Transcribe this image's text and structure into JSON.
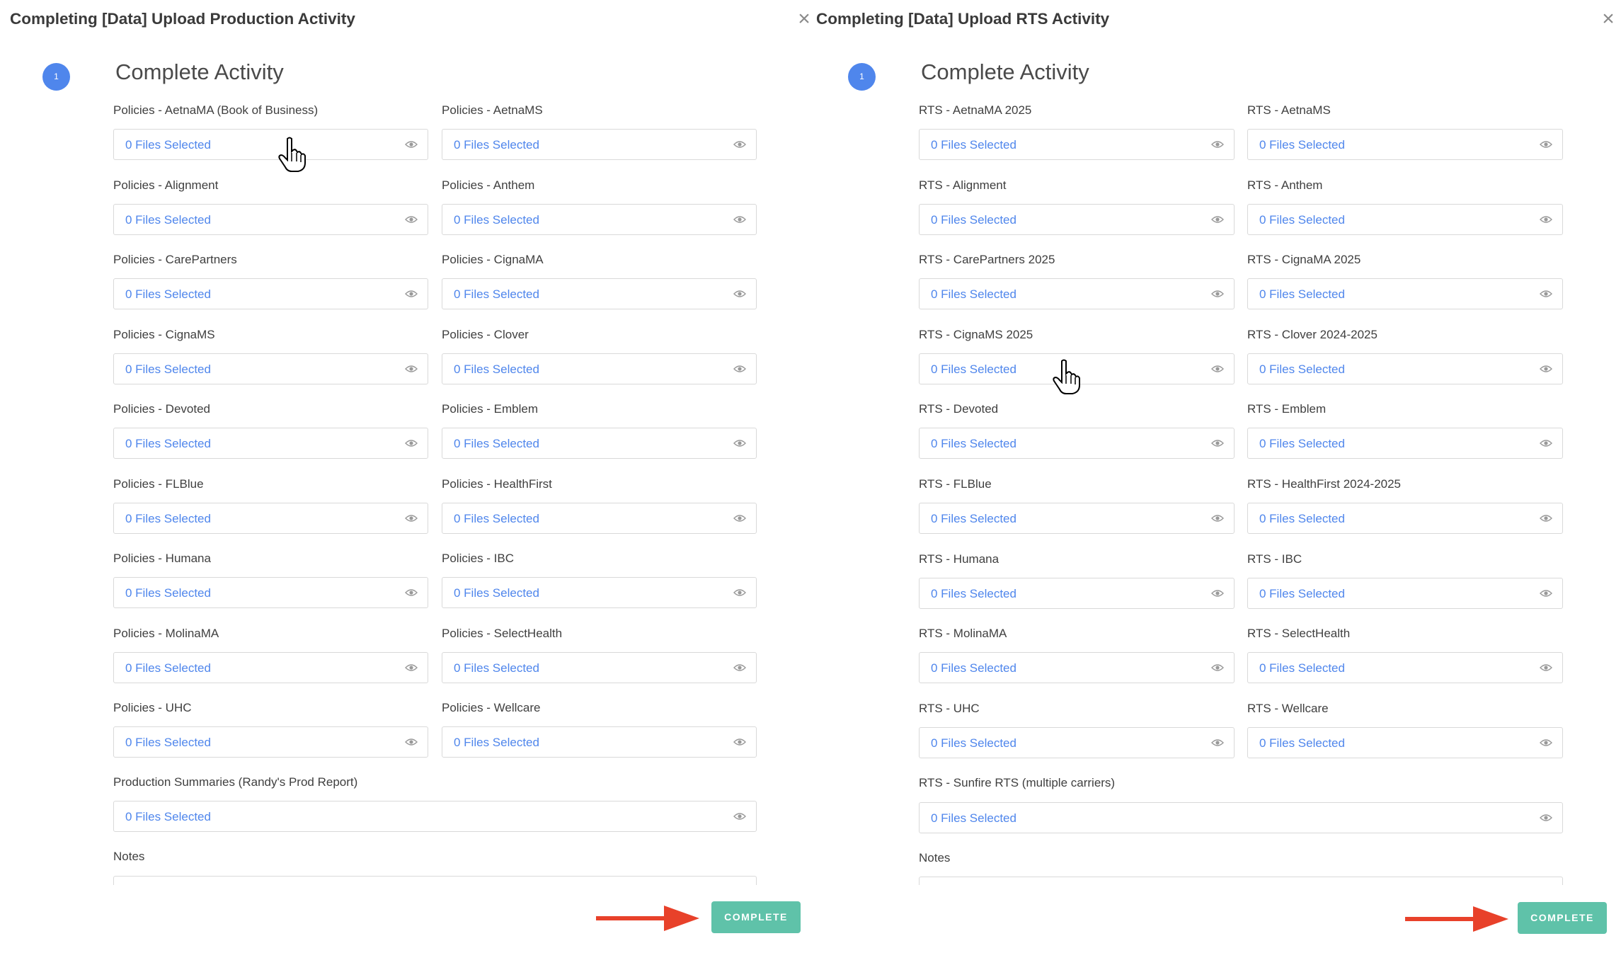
{
  "left": {
    "title": "Completing [Data] Upload Production Activity",
    "close": "×",
    "step_number": "1",
    "step_title": "Complete Activity",
    "fields": [
      {
        "label": "Policies - AetnaMA (Book of Business)",
        "value": "0 Files Selected"
      },
      {
        "label": "Policies - AetnaMS",
        "value": "0 Files Selected"
      },
      {
        "label": "Policies - Alignment",
        "value": "0 Files Selected"
      },
      {
        "label": "Policies - Anthem",
        "value": "0 Files Selected"
      },
      {
        "label": "Policies - CarePartners",
        "value": "0 Files Selected"
      },
      {
        "label": "Policies - CignaMA",
        "value": "0 Files Selected"
      },
      {
        "label": "Policies - CignaMS",
        "value": "0 Files Selected"
      },
      {
        "label": "Policies - Clover",
        "value": "0 Files Selected"
      },
      {
        "label": "Policies - Devoted",
        "value": "0 Files Selected"
      },
      {
        "label": "Policies - Emblem",
        "value": "0 Files Selected"
      },
      {
        "label": "Policies - FLBlue",
        "value": "0 Files Selected"
      },
      {
        "label": "Policies - HealthFirst",
        "value": "0 Files Selected"
      },
      {
        "label": "Policies - Humana",
        "value": "0 Files Selected"
      },
      {
        "label": "Policies - IBC",
        "value": "0 Files Selected"
      },
      {
        "label": "Policies - MolinaMA",
        "value": "0 Files Selected"
      },
      {
        "label": "Policies - SelectHealth",
        "value": "0 Files Selected"
      },
      {
        "label": "Policies - UHC",
        "value": "0 Files Selected"
      },
      {
        "label": "Policies - Wellcare",
        "value": "0 Files Selected"
      }
    ],
    "wide_field": {
      "label": "Production Summaries (Randy's Prod Report)",
      "value": "0 Files Selected"
    },
    "notes_label": "Notes",
    "complete_label": "COMPLETE"
  },
  "right": {
    "title": "Completing [Data] Upload RTS Activity",
    "close": "×",
    "step_number": "1",
    "step_title": "Complete Activity",
    "fields": [
      {
        "label": "RTS - AetnaMA 2025",
        "value": "0 Files Selected"
      },
      {
        "label": "RTS - AetnaMS",
        "value": "0 Files Selected"
      },
      {
        "label": "RTS - Alignment",
        "value": "0 Files Selected"
      },
      {
        "label": "RTS - Anthem",
        "value": "0 Files Selected"
      },
      {
        "label": "RTS - CarePartners 2025",
        "value": "0 Files Selected"
      },
      {
        "label": "RTS - CignaMA 2025",
        "value": "0 Files Selected"
      },
      {
        "label": "RTS - CignaMS 2025",
        "value": "0 Files Selected"
      },
      {
        "label": "RTS - Clover 2024-2025",
        "value": "0 Files Selected"
      },
      {
        "label": "RTS - Devoted",
        "value": "0 Files Selected"
      },
      {
        "label": "RTS - Emblem",
        "value": "0 Files Selected"
      },
      {
        "label": "RTS - FLBlue",
        "value": "0 Files Selected"
      },
      {
        "label": "RTS - HealthFirst 2024-2025",
        "value": "0 Files Selected"
      },
      {
        "label": "RTS - Humana",
        "value": "0 Files Selected"
      },
      {
        "label": "RTS - IBC",
        "value": "0 Files Selected"
      },
      {
        "label": "RTS - MolinaMA",
        "value": "0 Files Selected"
      },
      {
        "label": "RTS - SelectHealth",
        "value": "0 Files Selected"
      },
      {
        "label": "RTS - UHC",
        "value": "0 Files Selected"
      },
      {
        "label": "RTS - Wellcare",
        "value": "0 Files Selected"
      }
    ],
    "wide_field": {
      "label": "RTS - Sunfire RTS (multiple carriers)",
      "value": "0 Files Selected"
    },
    "notes_label": "Notes",
    "complete_label": "COMPLETE"
  },
  "colors": {
    "accent_blue": "#4f86ec",
    "complete_green": "#5fc2a9",
    "arrow_red": "#e8412a"
  },
  "icons": [
    "close-icon",
    "eye-icon",
    "hand-cursor-icon",
    "arrow-right-icon"
  ]
}
